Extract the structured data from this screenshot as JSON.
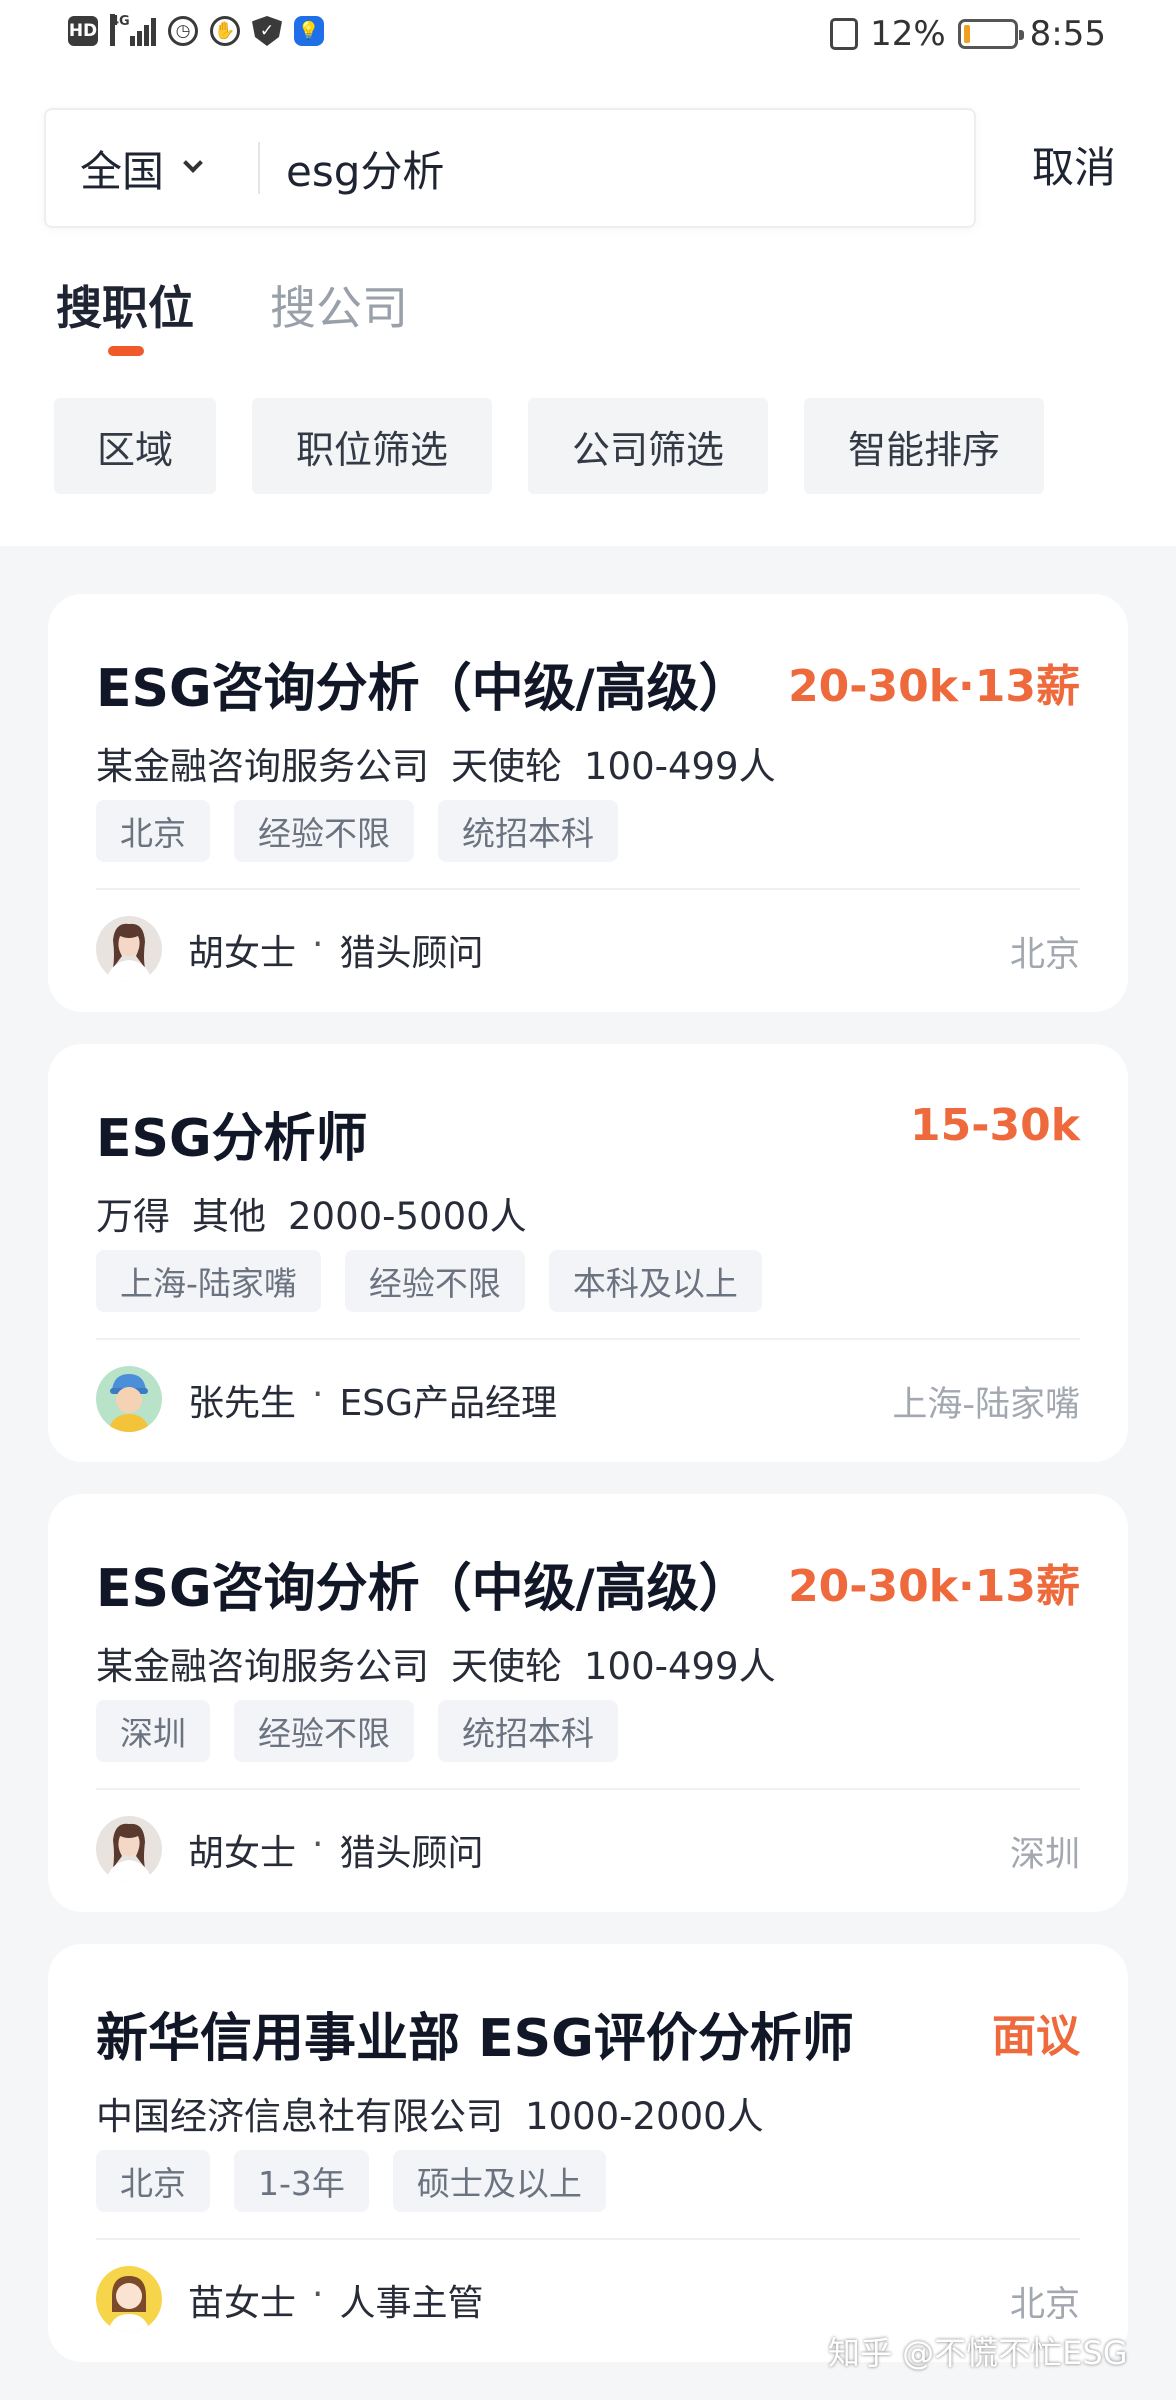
{
  "status_bar": {
    "left_icons": [
      "hd-icon",
      "signal-4g-icon",
      "alarm-icon",
      "hand-icon",
      "shield-icon",
      "bulb-app-icon"
    ],
    "hd_label": "HD",
    "net_label": "4G",
    "battery_percent": "12%",
    "battery_level": 0.12,
    "time": "8:55"
  },
  "search": {
    "region": "全国",
    "query": "esg分析",
    "cancel_label": "取消"
  },
  "tabs": [
    {
      "label": "搜职位",
      "active": true
    },
    {
      "label": "搜公司",
      "active": false
    }
  ],
  "filters": [
    "区域",
    "职位筛选",
    "公司筛选",
    "智能排序"
  ],
  "jobs": [
    {
      "title": "ESG咨询分析（中级/高级）",
      "salary": "20-30k·13薪",
      "company": [
        "某金融咨询服务公司",
        "天使轮",
        "100-499人"
      ],
      "tags": [
        "北京",
        "经验不限",
        "统招本科"
      ],
      "recruiter_name": "胡女士",
      "recruiter_role": "猎头顾问",
      "location": "北京",
      "avatar": "avatar-woman"
    },
    {
      "title": "ESG分析师",
      "salary": "15-30k",
      "company": [
        "万得",
        "其他",
        "2000-5000人"
      ],
      "tags": [
        "上海-陆家嘴",
        "经验不限",
        "本科及以上"
      ],
      "recruiter_name": "张先生",
      "recruiter_role": "ESG产品经理",
      "location": "上海-陆家嘴",
      "avatar": "avatar-man-cartoon"
    },
    {
      "title": "ESG咨询分析（中级/高级）",
      "salary": "20-30k·13薪",
      "company": [
        "某金融咨询服务公司",
        "天使轮",
        "100-499人"
      ],
      "tags": [
        "深圳",
        "经验不限",
        "统招本科"
      ],
      "recruiter_name": "胡女士",
      "recruiter_role": "猎头顾问",
      "location": "深圳",
      "avatar": "avatar-woman"
    },
    {
      "title": "新华信用事业部 ESG评价分析师",
      "salary": "面议",
      "company": [
        "中国经济信息社有限公司",
        "1000-2000人"
      ],
      "tags": [
        "北京",
        "1-3年",
        "硕士及以上"
      ],
      "recruiter_name": "苗女士",
      "recruiter_role": "人事主管",
      "location": "北京",
      "avatar": "avatar-woman-cartoon"
    }
  ],
  "watermark": "知乎 @不慌不忙ESG",
  "colors": {
    "accent": "#ee6a3c",
    "tab_indicator": "#f05a2b",
    "background": "#f5f6f8",
    "card": "#ffffff",
    "tag_bg": "#f3f4f7",
    "muted_text": "#a2a7b0"
  }
}
